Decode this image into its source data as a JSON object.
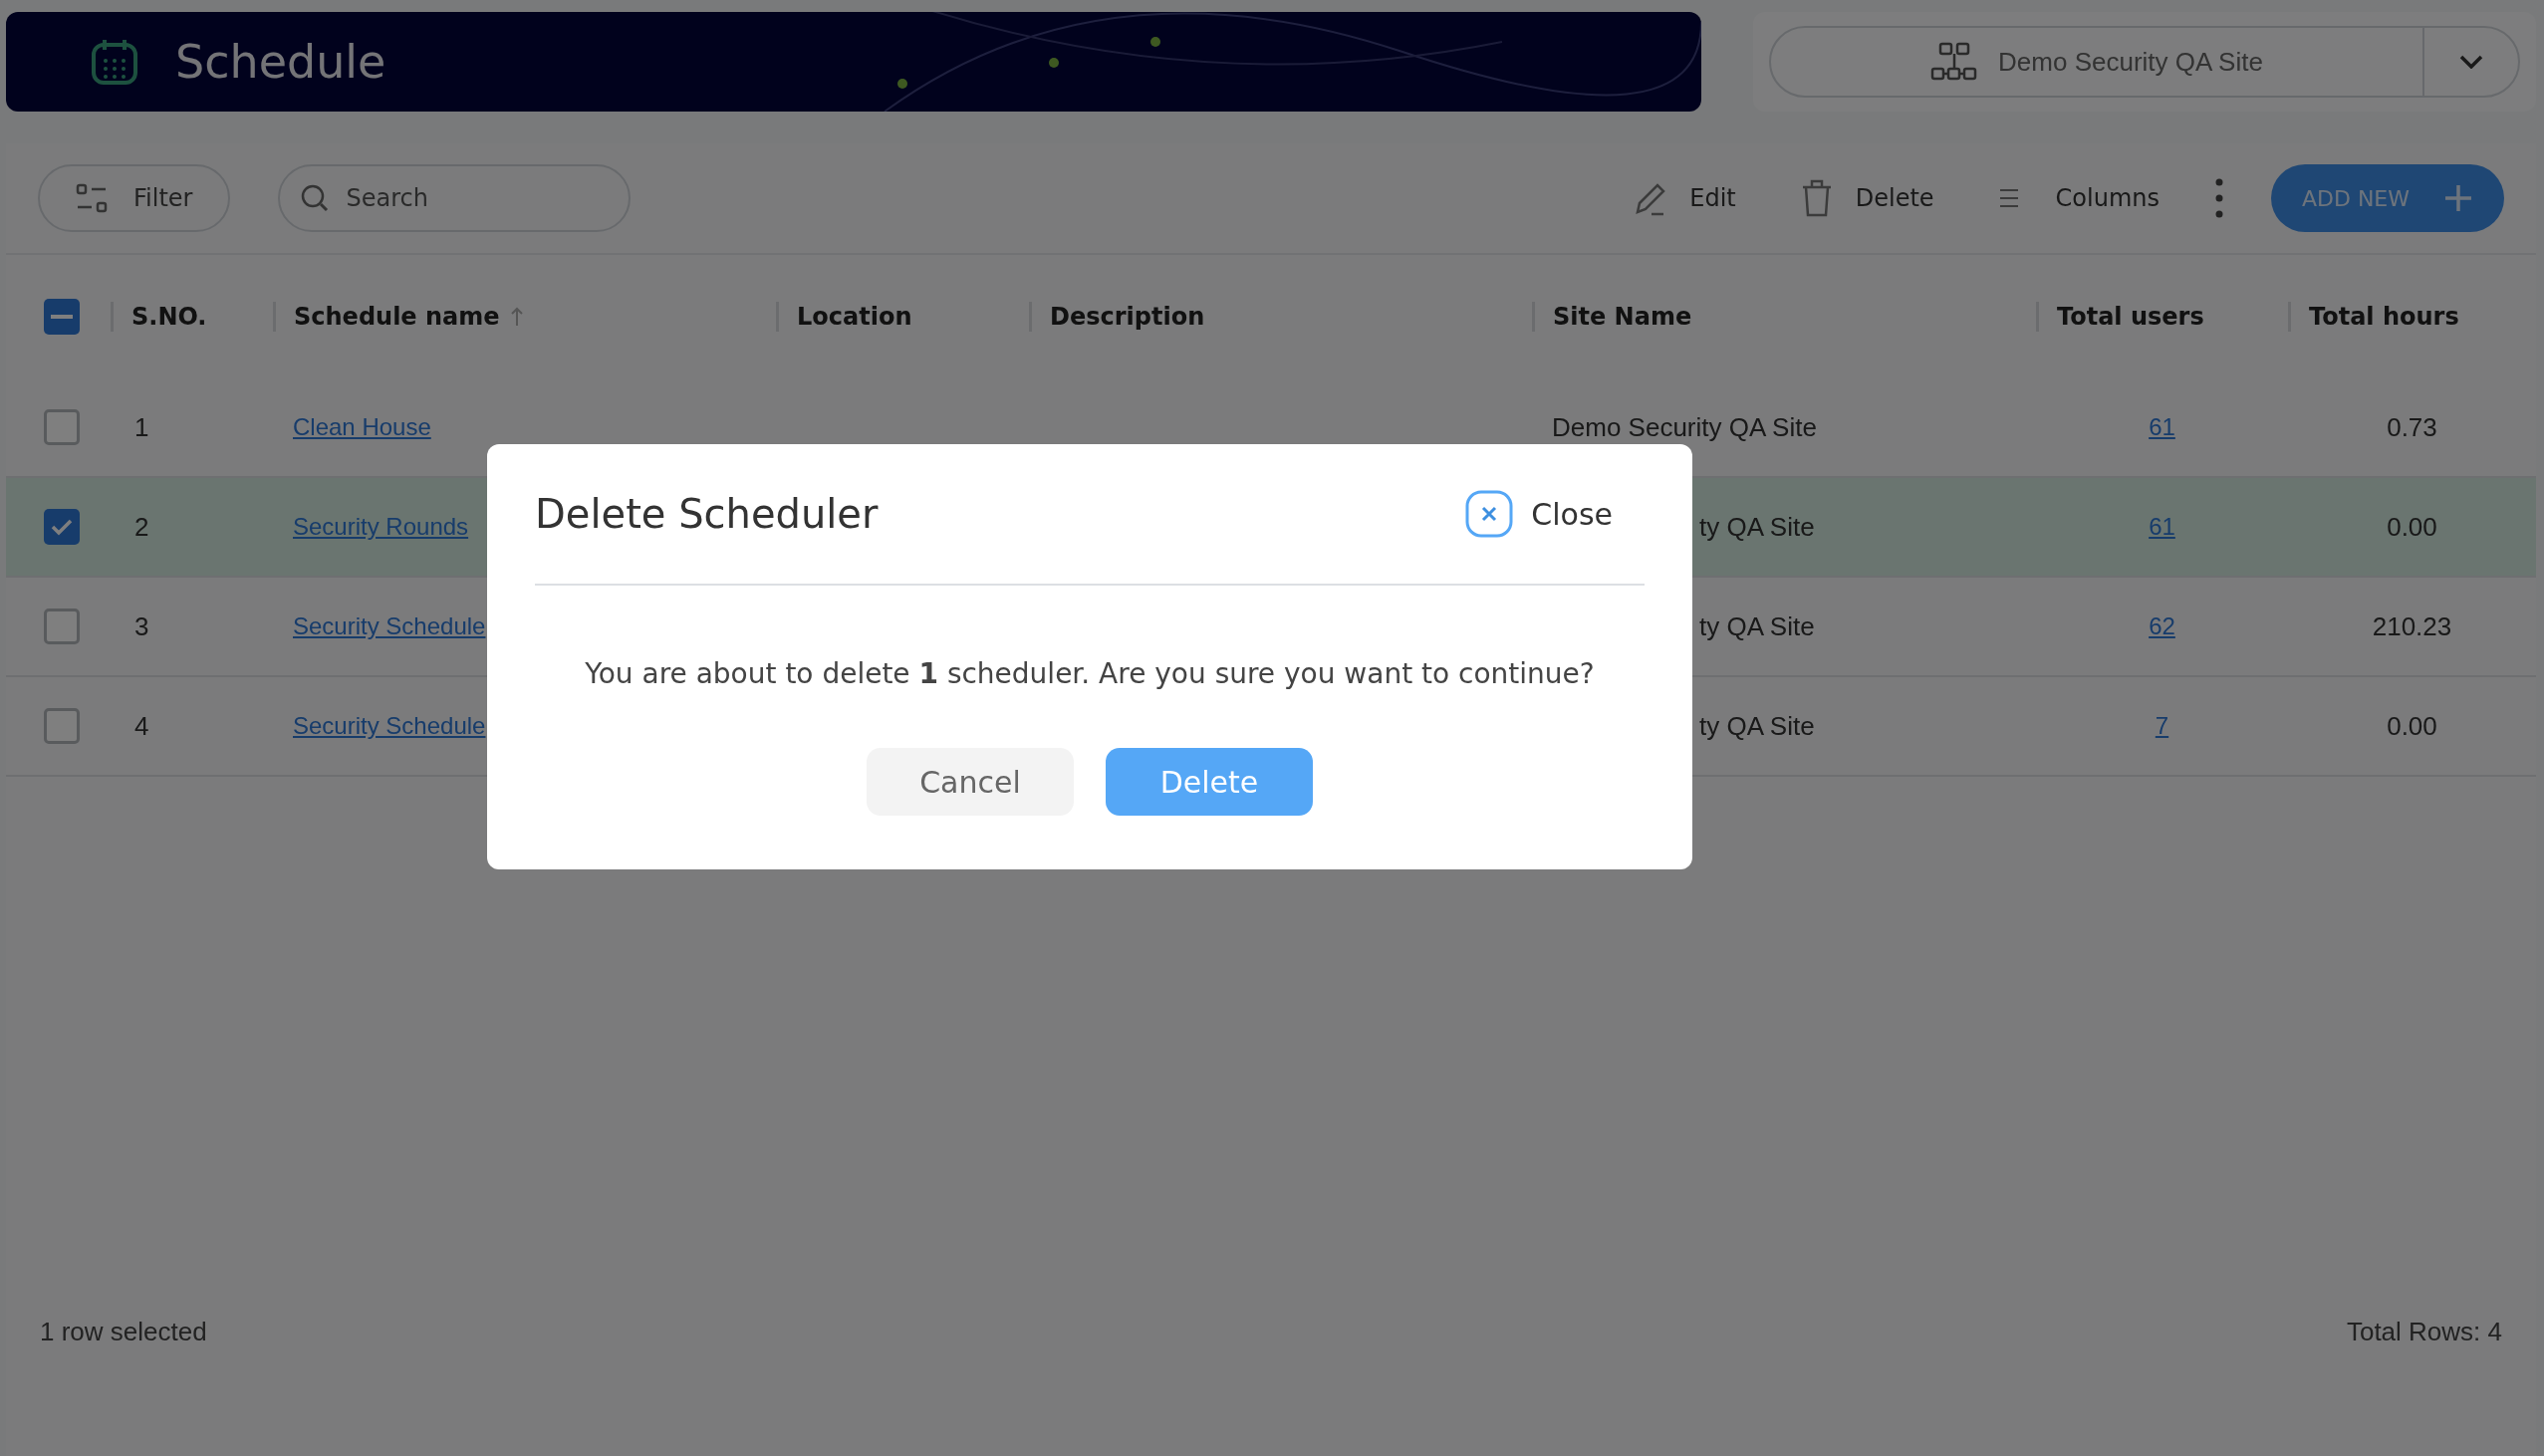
{
  "header": {
    "title": "Schedule"
  },
  "site_selector": {
    "value": "Demo Security QA Site"
  },
  "toolbar": {
    "filter": "Filter",
    "search": {
      "placeholder": "Search"
    },
    "edit": "Edit",
    "delete": "Delete",
    "columns": "Columns",
    "add_new": "ADD NEW"
  },
  "table": {
    "select_all": {
      "partial": true
    },
    "columns": [
      {
        "label": "S.NO.",
        "sorted": false
      },
      {
        "label": "Schedule name",
        "sorted": true
      },
      {
        "label": "Location",
        "sorted": false
      },
      {
        "label": "Description",
        "sorted": false
      },
      {
        "label": "Site Name",
        "sorted": false
      },
      {
        "label": "Total users",
        "sorted": false
      },
      {
        "label": "Total hours",
        "sorted": false
      }
    ],
    "rows": [
      {
        "checked": false,
        "selected": false,
        "sno": "1",
        "name": "Clean House",
        "site": "Demo Security QA Site",
        "users": "61",
        "hours": "0.73"
      },
      {
        "checked": true,
        "selected": true,
        "sno": "2",
        "name": "Security Rounds",
        "site": "ty QA Site",
        "users": "61",
        "hours": "0.00"
      },
      {
        "checked": false,
        "selected": false,
        "sno": "3",
        "name": "Security Schedule",
        "site": "ty QA Site",
        "users": "62",
        "hours": "210.23"
      },
      {
        "checked": false,
        "selected": false,
        "sno": "4",
        "name": "Security Schedule",
        "site": "ty QA Site",
        "users": "7",
        "hours": "0.00"
      }
    ]
  },
  "footer": {
    "selection": "1 row selected",
    "total": "Total Rows: 4"
  },
  "dialog": {
    "title": "Delete Scheduler",
    "close": "Close",
    "message": "You are about to delete **1** scheduler. Are you sure you want to continue?",
    "cancel": "Cancel",
    "confirm": "Delete"
  }
}
